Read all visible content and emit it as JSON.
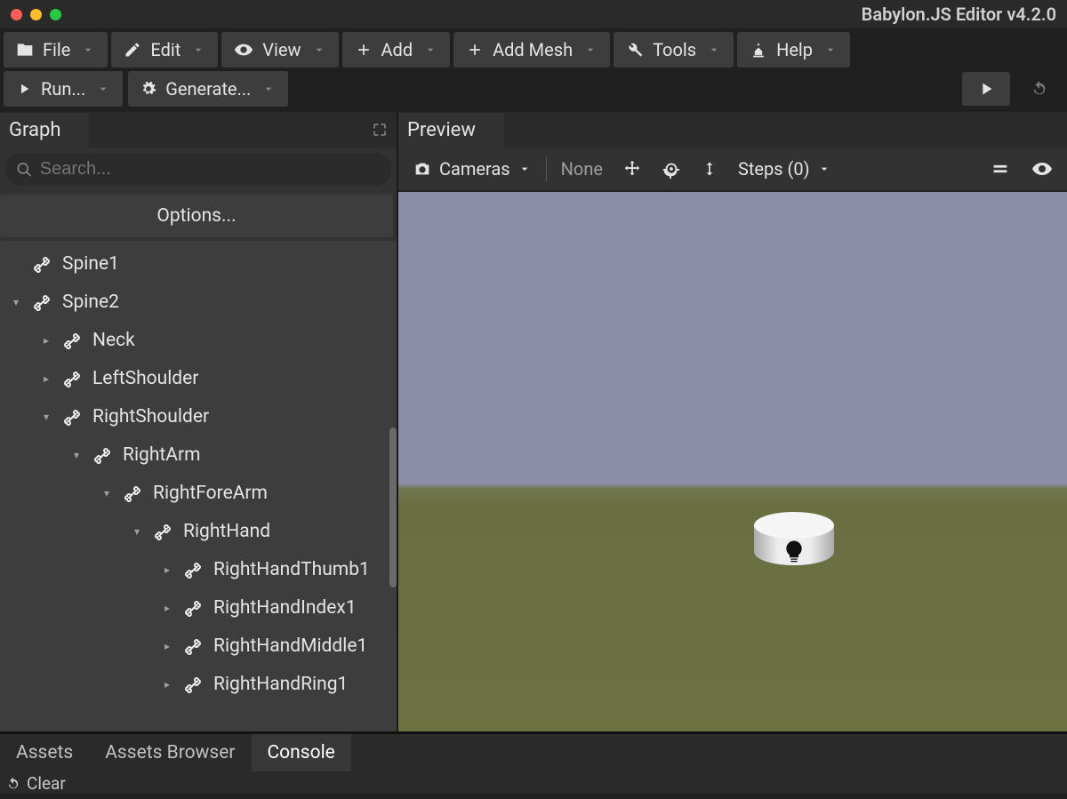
{
  "app_title": "Babylon.JS Editor v4.2.0",
  "menubar": {
    "file": "File",
    "edit": "Edit",
    "view": "View",
    "add": "Add",
    "add_mesh": "Add Mesh",
    "tools": "Tools",
    "help": "Help"
  },
  "toolbar2": {
    "run": "Run...",
    "generate": "Generate..."
  },
  "left_panel": {
    "tab": "Graph",
    "search_placeholder": "Search...",
    "options": "Options..."
  },
  "tree": [
    {
      "indent": 0,
      "exp": "",
      "label": "Spine1"
    },
    {
      "indent": 0,
      "exp": "▾",
      "label": "Spine2"
    },
    {
      "indent": 1,
      "exp": "▸",
      "label": "Neck"
    },
    {
      "indent": 1,
      "exp": "▸",
      "label": "LeftShoulder"
    },
    {
      "indent": 1,
      "exp": "▾",
      "label": "RightShoulder"
    },
    {
      "indent": 2,
      "exp": "▾",
      "label": "RightArm"
    },
    {
      "indent": 3,
      "exp": "▾",
      "label": "RightForeArm"
    },
    {
      "indent": 4,
      "exp": "▾",
      "label": "RightHand"
    },
    {
      "indent": 5,
      "exp": "▸",
      "label": "RightHandThumb1"
    },
    {
      "indent": 5,
      "exp": "▸",
      "label": "RightHandIndex1"
    },
    {
      "indent": 5,
      "exp": "▸",
      "label": "RightHandMiddle1"
    },
    {
      "indent": 5,
      "exp": "▸",
      "label": "RightHandRing1"
    }
  ],
  "preview": {
    "tab": "Preview",
    "cameras": "Cameras",
    "none": "None",
    "steps": "Steps (0)"
  },
  "bottom": {
    "assets": "Assets",
    "assets_browser": "Assets Browser",
    "console": "Console",
    "clear": "Clear"
  }
}
